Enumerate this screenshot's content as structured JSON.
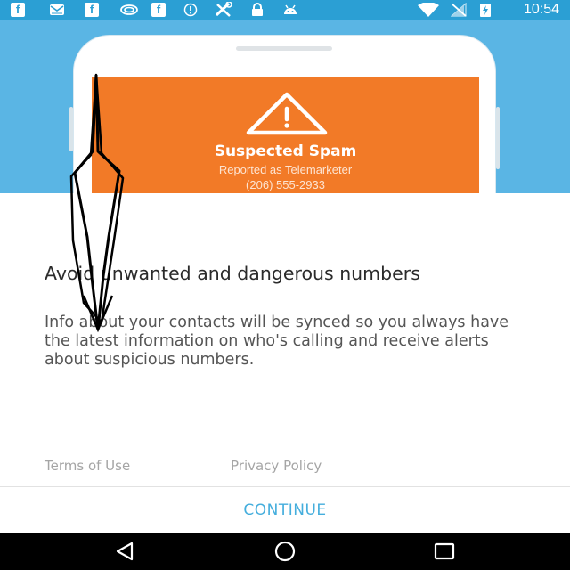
{
  "status_bar": {
    "icons": [
      "facebook-icon",
      "mail-icon",
      "facebook-icon",
      "cast-icon",
      "facebook-icon",
      "alert-circle-icon",
      "tools-icon",
      "lock-icon",
      "android-icon",
      "wifi-icon",
      "no-signal-icon",
      "battery-charging-icon"
    ],
    "fb_glyph": "f",
    "time": "10:54"
  },
  "hero": {
    "card": {
      "title": "Suspected Spam",
      "subtitle": "Reported as Telemarketer",
      "phone_number": "(206) 555-2933",
      "icon": "warning-icon",
      "color": "#f27a27"
    },
    "background_color": "#5ab5e4"
  },
  "content": {
    "heading": "Avoid unwanted and dangerous numbers",
    "body": "Info about your contacts will be synced so you always have the latest information on who's calling and receive alerts about suspicious numbers."
  },
  "links": {
    "terms": "Terms of Use",
    "privacy": "Privacy Policy"
  },
  "continue_button": {
    "label": "CONTINUE",
    "color": "#45aedd"
  },
  "nav_bar": {
    "icons": [
      "back-icon",
      "home-icon",
      "recents-icon"
    ]
  }
}
